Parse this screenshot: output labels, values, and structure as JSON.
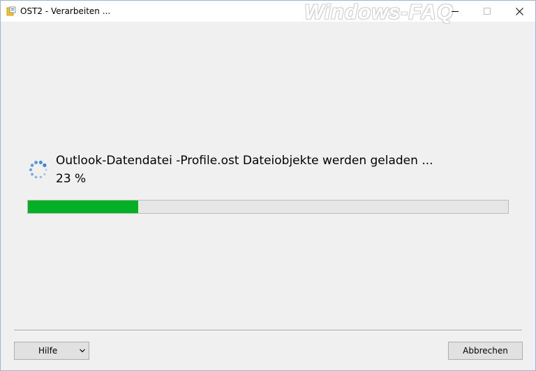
{
  "window": {
    "title": "OST2 - Verarbeiten ...",
    "watermark": "Windows-FAQ"
  },
  "status": {
    "message": "Outlook-Datendatei -Profile.ost Dateiobjekte werden geladen ...",
    "percent_label": "23 %",
    "progress_fraction": 0.23
  },
  "footer": {
    "help_label": "Hilfe",
    "cancel_label": "Abbrechen"
  },
  "icons": {
    "app": "app-icon",
    "spinner": "loading-spinner-icon",
    "minimize": "minimize-icon",
    "maximize": "maximize-icon",
    "close": "close-icon",
    "chevron": "chevron-down-icon"
  },
  "colors": {
    "progress_fill": "#06b025",
    "spinner": "#2c7fd3"
  }
}
